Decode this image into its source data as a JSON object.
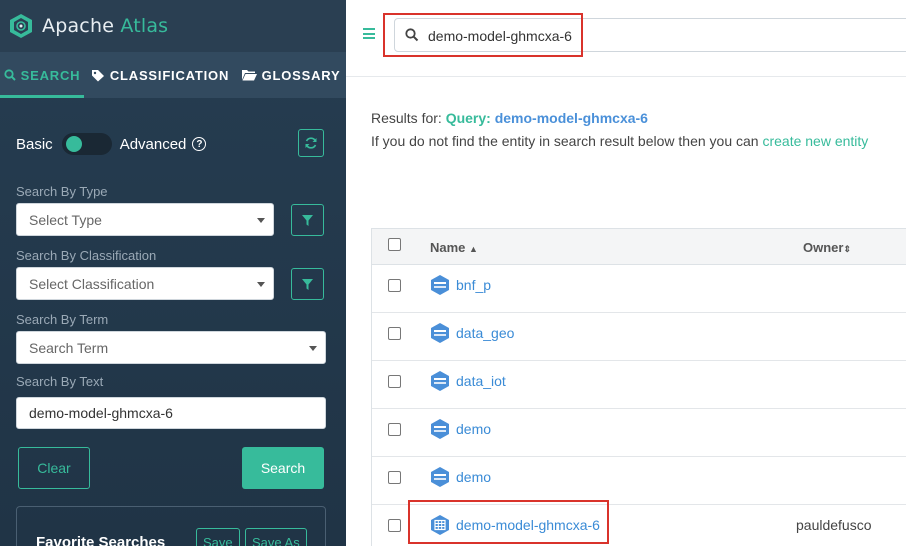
{
  "brand": {
    "name_part1": "Apache ",
    "name_part2": "Atlas"
  },
  "sidebar": {
    "tabs": [
      {
        "label": "SEARCH",
        "active": true
      },
      {
        "label": "CLASSIFICATION",
        "active": false
      },
      {
        "label": "GLOSSARY",
        "active": false
      }
    ],
    "mode": {
      "basic_label": "Basic",
      "advanced_label": "Advanced",
      "help_glyph": "?"
    },
    "type": {
      "label": "Search By Type",
      "placeholder": "Select Type"
    },
    "classification": {
      "label": "Search By Classification",
      "placeholder": "Select Classification"
    },
    "term": {
      "label": "Search By Term",
      "placeholder": "Search Term"
    },
    "text": {
      "label": "Search By Text",
      "value": "demo-model-ghmcxa-6"
    },
    "clear_label": "Clear",
    "search_label": "Search",
    "favorites": {
      "title": "Favorite Searches",
      "save_label": "Save",
      "save_as_label": "Save As"
    }
  },
  "topbar": {
    "search_value": "demo-model-ghmcxa-6"
  },
  "results": {
    "prefix": "Results for: ",
    "query_label": "Query:",
    "query_value": " demo-model-ghmcxa-6",
    "notfound_text": "If you do not find the entity in search result below then you can ",
    "create_link": "create new entity"
  },
  "table": {
    "headers": {
      "name": "Name",
      "owner": "Owner"
    },
    "rows": [
      {
        "name": "bnf_p",
        "owner": "",
        "icon": "database-icon"
      },
      {
        "name": "data_geo",
        "owner": "",
        "icon": "database-icon"
      },
      {
        "name": "data_iot",
        "owner": "",
        "icon": "database-icon"
      },
      {
        "name": "demo",
        "owner": "",
        "icon": "database-icon"
      },
      {
        "name": "demo",
        "owner": "",
        "icon": "database-icon"
      },
      {
        "name": "demo-model-ghmcxa-6",
        "owner": "pauldefusco",
        "icon": "table-icon"
      }
    ]
  },
  "colors": {
    "accent": "#37bb9b",
    "link": "#3a8bd6",
    "sidebar": "#263d51",
    "highlight": "#d9332b"
  }
}
